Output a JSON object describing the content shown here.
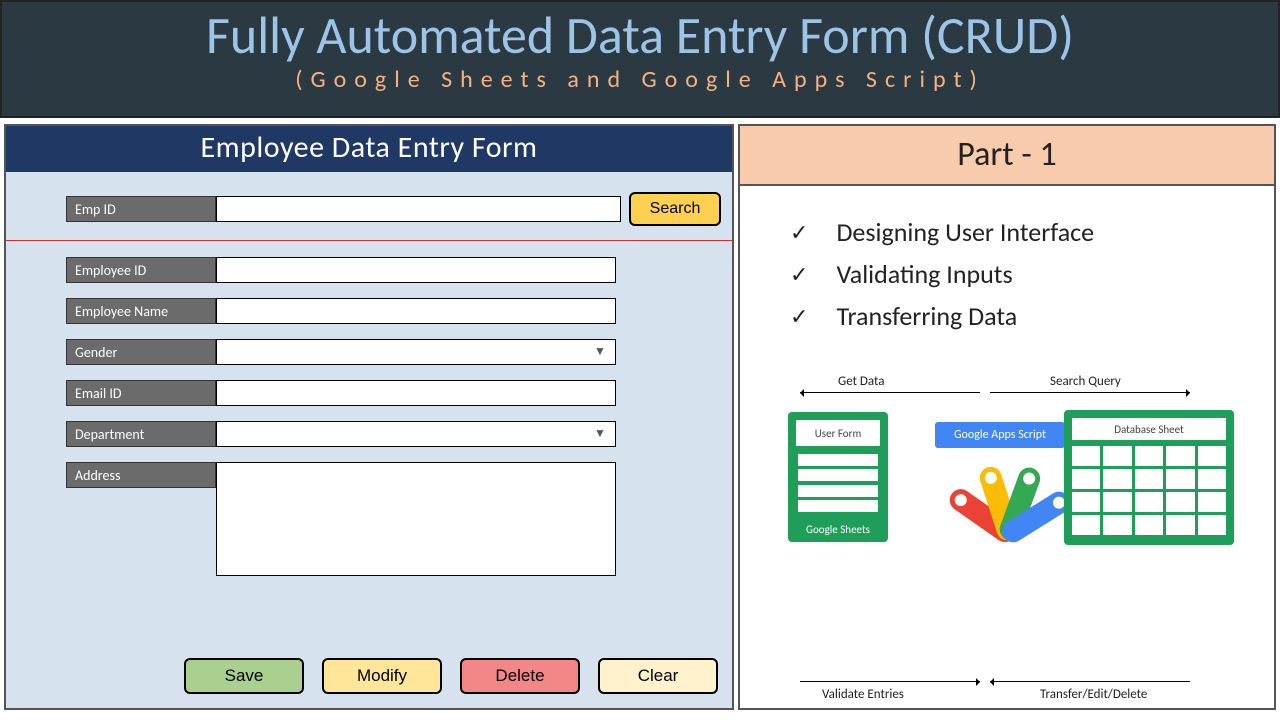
{
  "banner": {
    "title": "Fully Automated Data Entry Form (CRUD)",
    "subtitle": "(Google Sheets and Google Apps Script)"
  },
  "form": {
    "header": "Employee Data Entry Form",
    "search_label": "Emp ID",
    "search_value": "",
    "search_button": "Search",
    "fields": {
      "emp_id_label": "Employee ID",
      "emp_name_label": "Employee Name",
      "gender_label": "Gender",
      "email_label": "Email ID",
      "dept_label": "Department",
      "address_label": "Address"
    },
    "buttons": {
      "save": "Save",
      "modify": "Modify",
      "delete": "Delete",
      "clear": "Clear"
    }
  },
  "right": {
    "part_title": "Part - 1",
    "bullets": [
      "Designing User Interface",
      "Validating Inputs",
      "Transferring Data"
    ],
    "diagram": {
      "get_data": "Get Data",
      "search_query": "Search Query",
      "validate": "Validate Entries",
      "transfer": "Transfer/Edit/Delete",
      "user_form": "User Form",
      "google_sheets": "Google Sheets",
      "gas": "Google Apps Script",
      "db_sheet": "Database Sheet"
    }
  }
}
